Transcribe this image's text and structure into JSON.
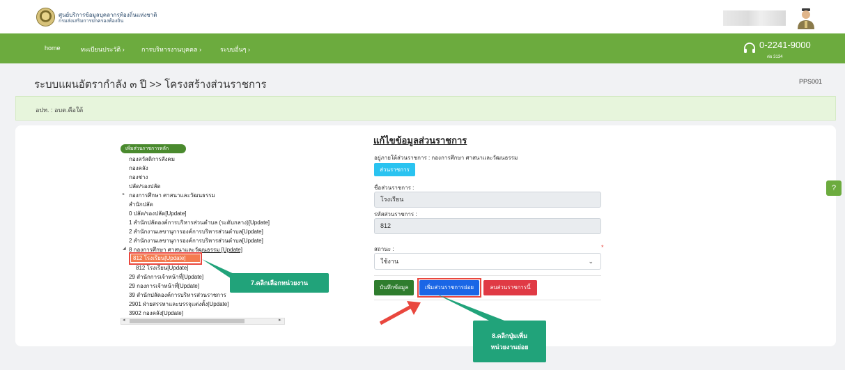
{
  "header": {
    "org_line1": "ศูนย์บริการข้อมูลบุคลากรท้องถิ่นแห่งชาติ",
    "org_line2": "กรมส่งเสริมการปกครองท้องถิ่น"
  },
  "nav": {
    "items": [
      "home",
      "ทะเบียนประวัติ ›",
      "การบริหารงานบุคคล ›",
      "ระบบอื่นๆ ›"
    ],
    "phone": "0-2241-9000",
    "phone_ext": "ต่อ 3134"
  },
  "page": {
    "title": "ระบบแผนอัตรากำลัง ๓ ปี >> โครงสร้างส่วนราชการ",
    "code": "PPS001",
    "info": "อปท. : อบต.คือใต้"
  },
  "tree": {
    "add_main_label": "เพิ่มส่วนราชการหลัก",
    "items": [
      "กองสวัสดิการสังคม",
      "กองคลัง",
      "กองช่าง",
      "ปลัด/รองปลัด",
      "กองการศึกษา ศาสนาและวัฒนธรรม",
      "สำนักปลัด",
      "0 ปลัด/รองปลัด[Update]",
      "1 สำนักปลัดองค์การบริหารส่วนตำบล (ระดับกลาง)[Update]",
      "2 สำนักงานเลขานุการองค์การบริหารส่วนตำบล[Update]",
      "2 สำนักงานเลขานุการองค์การบริหารส่วนตำบล[Update]",
      "8 กองการศึกษา ศาสนาและวัฒนธรรม [Update]",
      "812 โรงเรียน[Update]",
      "812 โรงเรียน[Update]",
      "29 สำนักการเจ้าหน้าที่[Update]",
      "29 กองการเจ้าหน้าที่[Update]",
      "39 สำนักปลัดองค์การบริหารส่วนราชการ",
      "2901 ฝ่ายสรรหาและบรรจุแต่งตั้ง[Update]",
      "3902 กองคลัง[Update]"
    ]
  },
  "form": {
    "title": "แก้ไขข้อมูลส่วนราชการ",
    "under_label": "อยู่ภายใต้ส่วนราชการ : กองการศึกษา ศาสนาและวัฒนธรรม",
    "parent_button": "ส่วนราชการ",
    "name_label": "ชื่อส่วนราชการ :",
    "name_value": "โรงเรียน",
    "code_label": "รหัสส่วนราชการ :",
    "code_value": "812",
    "status_label": "สถานะ :",
    "status_value": "ใช้งาน",
    "required_mark": "*",
    "save_button": "บันทึกข้อมูล",
    "add_sub_button": "เพิ่มส่วนราชการย่อย",
    "delete_button": "ลบส่วนราชการนี้"
  },
  "annotations": {
    "step7": "7.คลิกเลือกหน่วยงาน",
    "step8_line1": "8.คลิกปุ่มเพิ่ม",
    "step8_line2": "หน่วยงานย่อย"
  },
  "colors": {
    "nav_green": "#6cab3e",
    "callout_teal": "#21a37a",
    "highlight_red": "#e9473e"
  }
}
